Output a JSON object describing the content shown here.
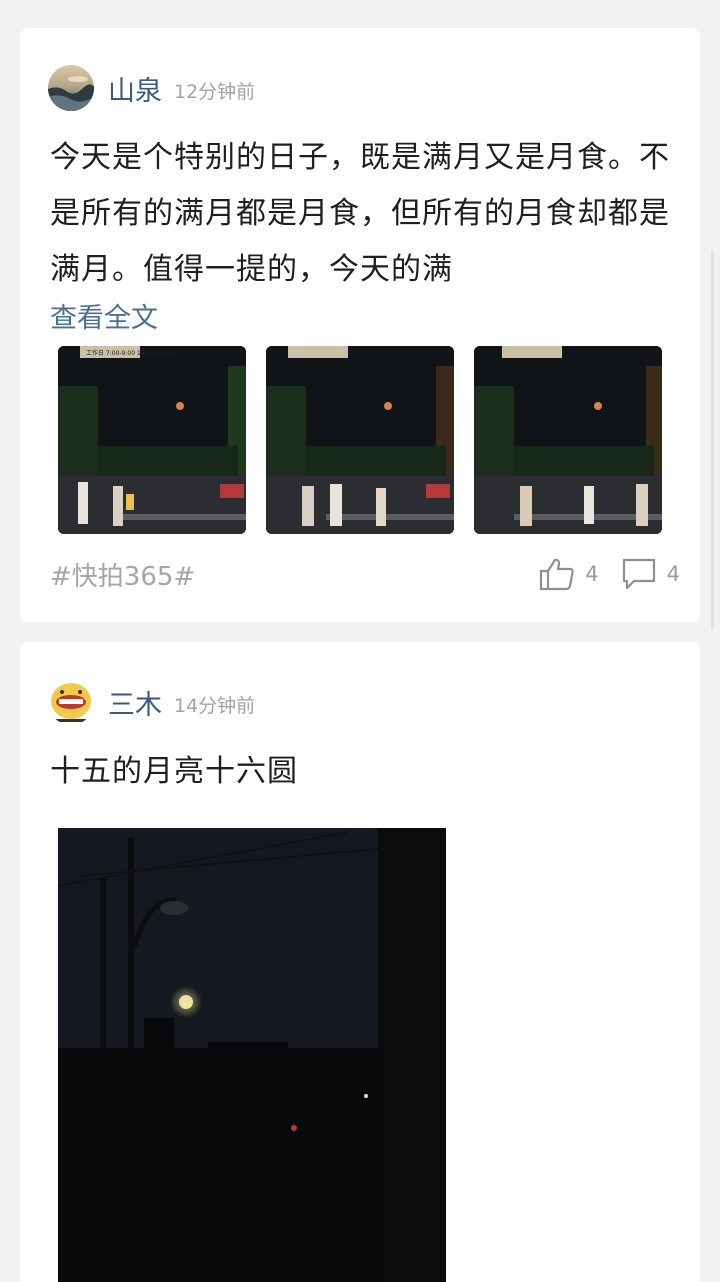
{
  "posts": [
    {
      "username": "山泉",
      "time": "12分钟前",
      "text": "今天是个特别的日子，既是满月又是月食。不是所有的满月都是月食，但所有的月食却都是满月。值得一提的，今天的满",
      "more_label": "查看全文",
      "sign_text": "工作日 7:00-9:00 16:30-18:30",
      "hashtag": "#快拍365#",
      "like_count": "4",
      "comment_count": "4"
    },
    {
      "username": "三木",
      "time": "14分钟前",
      "text": "十五的月亮十六圆"
    }
  ],
  "colors": {
    "background": "#f2f2f2",
    "card": "#ffffff",
    "username": "#3e5a7a",
    "link": "#4a6f95",
    "muted": "#a6a6a6"
  },
  "icons": [
    "thumbs-up-icon",
    "comment-icon"
  ]
}
